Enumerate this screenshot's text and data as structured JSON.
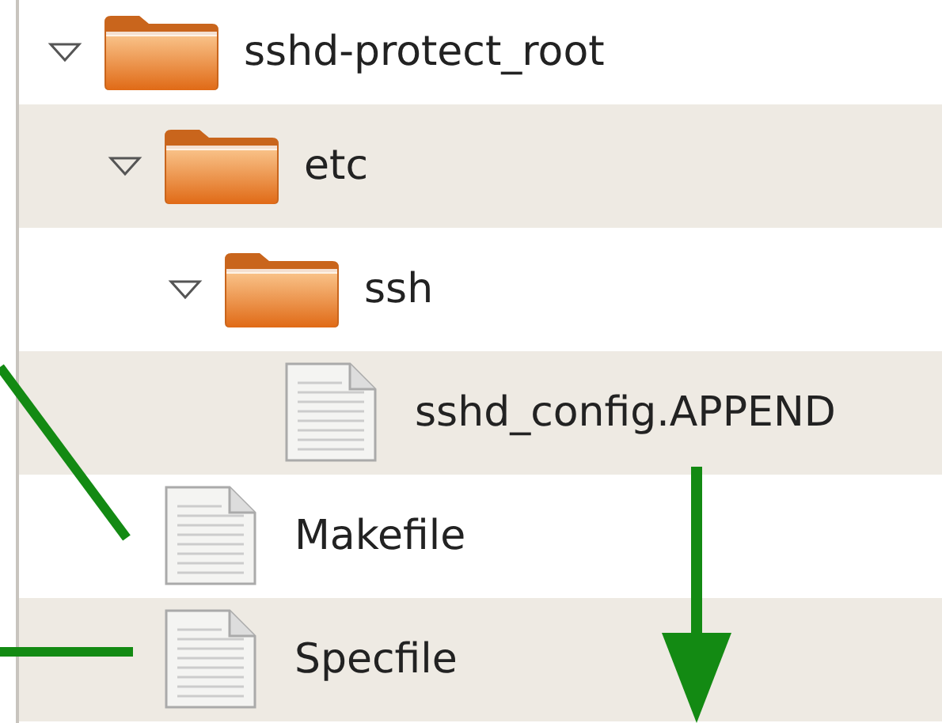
{
  "tree": {
    "items": [
      {
        "name": "sshd-protect_root",
        "kind": "folder",
        "expanded": true,
        "children": [
          {
            "name": "etc",
            "kind": "folder",
            "expanded": true,
            "children": [
              {
                "name": "ssh",
                "kind": "folder",
                "expanded": true,
                "children": [
                  {
                    "name": "sshd_config.APPEND",
                    "kind": "file"
                  }
                ]
              }
            ]
          },
          {
            "name": "Makefile",
            "kind": "file"
          },
          {
            "name": "Specfile",
            "kind": "file"
          }
        ]
      }
    ]
  }
}
